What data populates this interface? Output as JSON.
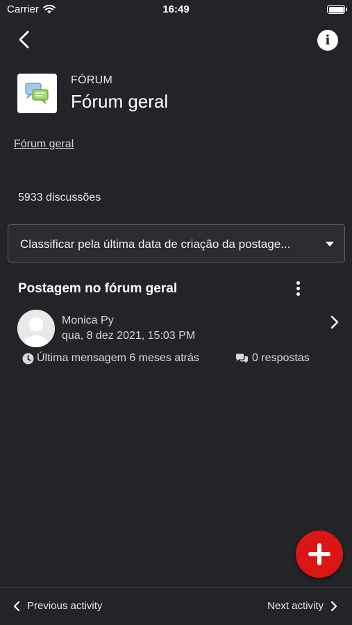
{
  "status_bar": {
    "carrier": "Carrier",
    "time": "16:49"
  },
  "header": {
    "back_icon": "chevron-left-icon",
    "info_label": "i"
  },
  "module": {
    "type_label": "FÓRUM",
    "title": "Fórum geral"
  },
  "breadcrumb": "Fórum geral",
  "discussion_count": "5933 discussões",
  "sort": {
    "selected": "Classificar pela última data de criação da postage..."
  },
  "post": {
    "title": "Postagem no fórum geral",
    "author": "Monica Py",
    "date": "qua, 8 dez 2021, 15:03 PM",
    "last_message": "Última mensagem 6 meses atrás",
    "replies": "0 respostas"
  },
  "nav": {
    "previous": "Previous activity",
    "next": "Next activity"
  },
  "colors": {
    "background": "#222427",
    "fab": "#d91515",
    "text": "#ffffff"
  }
}
